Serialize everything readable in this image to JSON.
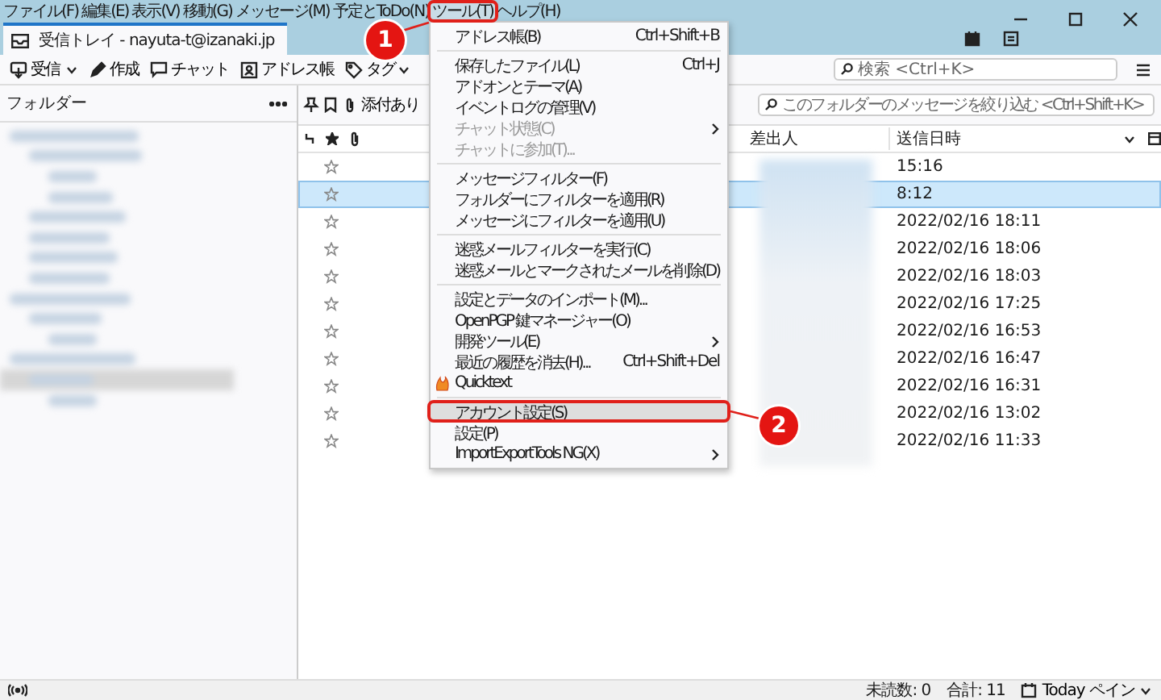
{
  "menubar": [
    {
      "label": "ファイル(F)",
      "selected": false
    },
    {
      "label": "編集(E)",
      "selected": false
    },
    {
      "label": "表示(V)",
      "selected": false
    },
    {
      "label": "移動(G)",
      "selected": false
    },
    {
      "label": "メッセージ(M)",
      "selected": false
    },
    {
      "label": "予定とToDo(N)",
      "selected": false
    },
    {
      "label": "ツール(T)",
      "selected": true
    },
    {
      "label": "ヘルプ(H)",
      "selected": false
    }
  ],
  "tab": {
    "title": "受信トレイ - nayuta-t@izanaki.jp"
  },
  "toolbar": {
    "buttons": [
      {
        "kind": "get",
        "label": "受信"
      },
      {
        "kind": "write",
        "label": "作成"
      },
      {
        "kind": "chat",
        "label": "チャット"
      },
      {
        "kind": "address",
        "label": "アドレス帳"
      },
      {
        "kind": "tag",
        "label": "タグ"
      }
    ],
    "search": {
      "placeholder": "検索 <Ctrl+K>"
    }
  },
  "folder_pane": {
    "title": "フォルダー"
  },
  "message_list": {
    "quick_filter": {
      "attachment_label": "添付あり",
      "filter": {
        "placeholder": "このフォルダーのメッセージを絞り込む <Ctrl+Shift+K>"
      }
    },
    "columns": [
      {
        "label": "差出人"
      },
      {
        "label": "送信日時"
      }
    ],
    "rows": [
      {
        "date": "15:16",
        "selected": false
      },
      {
        "date": "8:12",
        "selected": true
      },
      {
        "date": "2022/02/16 18:11",
        "selected": false
      },
      {
        "date": "2022/02/16 18:06",
        "selected": false
      },
      {
        "date": "2022/02/16 18:03",
        "selected": false
      },
      {
        "date": "2022/02/16 17:25",
        "selected": false
      },
      {
        "date": "2022/02/16 16:53",
        "selected": false
      },
      {
        "date": "2022/02/16 16:47",
        "selected": false
      },
      {
        "date": "2022/02/16 16:31",
        "selected": false
      },
      {
        "date": "2022/02/16 13:02",
        "selected": false
      },
      {
        "date": "2022/02/16 11:33",
        "selected": false
      }
    ]
  },
  "tools_menu": [
    {
      "kind": "item",
      "label": "アドレス帳(B)",
      "shortcut": "Ctrl+Shift+B",
      "disabled": false,
      "submenu": false,
      "selected": false
    },
    {
      "kind": "separator"
    },
    {
      "kind": "item",
      "label": "保存したファイル(L)",
      "shortcut": "Ctrl+J",
      "disabled": false,
      "submenu": false,
      "selected": false
    },
    {
      "kind": "item",
      "label": "アドオンとテーマ(A)",
      "disabled": false,
      "submenu": false,
      "selected": false
    },
    {
      "kind": "item",
      "label": "イベントログの管理(V)",
      "disabled": false,
      "submenu": false,
      "selected": false
    },
    {
      "kind": "item",
      "label": "チャット状態(C)",
      "disabled": true,
      "submenu": true,
      "selected": false
    },
    {
      "kind": "item",
      "label": "チャットに参加(T)...",
      "disabled": true,
      "submenu": false,
      "selected": false
    },
    {
      "kind": "separator"
    },
    {
      "kind": "item",
      "label": "メッセージフィルター(F)",
      "disabled": false,
      "submenu": false,
      "selected": false
    },
    {
      "kind": "item",
      "label": "フォルダーにフィルターを適用(R)",
      "disabled": false,
      "submenu": false,
      "selected": false
    },
    {
      "kind": "item",
      "label": "メッセージにフィルターを適用(U)",
      "disabled": false,
      "submenu": false,
      "selected": false
    },
    {
      "kind": "separator"
    },
    {
      "kind": "item",
      "label": "迷惑メールフィルターを実行(C)",
      "disabled": false,
      "submenu": false,
      "selected": false
    },
    {
      "kind": "item",
      "label": "迷惑メールとマークされたメールを削除(D)",
      "disabled": false,
      "submenu": false,
      "selected": false
    },
    {
      "kind": "separator"
    },
    {
      "kind": "item",
      "label": "設定とデータのインポート(M)...",
      "disabled": false,
      "submenu": false,
      "selected": false
    },
    {
      "kind": "item",
      "label": "OpenPGP 鍵マネージャー(O)",
      "disabled": false,
      "submenu": false,
      "selected": false
    },
    {
      "kind": "item",
      "label": "開発ツール(E)",
      "disabled": false,
      "submenu": true,
      "selected": false
    },
    {
      "kind": "item",
      "label": "最近の履歴を消去(H)...",
      "shortcut": "Ctrl+Shift+Del",
      "disabled": false,
      "submenu": false,
      "selected": false
    },
    {
      "kind": "addon",
      "label": "Quicktext",
      "disabled": false,
      "submenu": false,
      "selected": false
    },
    {
      "kind": "separator"
    },
    {
      "kind": "item",
      "label": "アカウント設定(S)",
      "disabled": false,
      "submenu": false,
      "selected": true
    },
    {
      "kind": "item",
      "label": "設定(P)",
      "disabled": false,
      "submenu": false,
      "selected": false
    },
    {
      "kind": "item",
      "label": "ImportExportTools NG(X)",
      "disabled": false,
      "submenu": true,
      "selected": false
    }
  ],
  "callouts": [
    {
      "number": "1"
    },
    {
      "number": "2"
    }
  ],
  "status_bar": {
    "unread": "未読数: 0",
    "total": "合計: 11",
    "today_pane": "Today ペイン"
  }
}
